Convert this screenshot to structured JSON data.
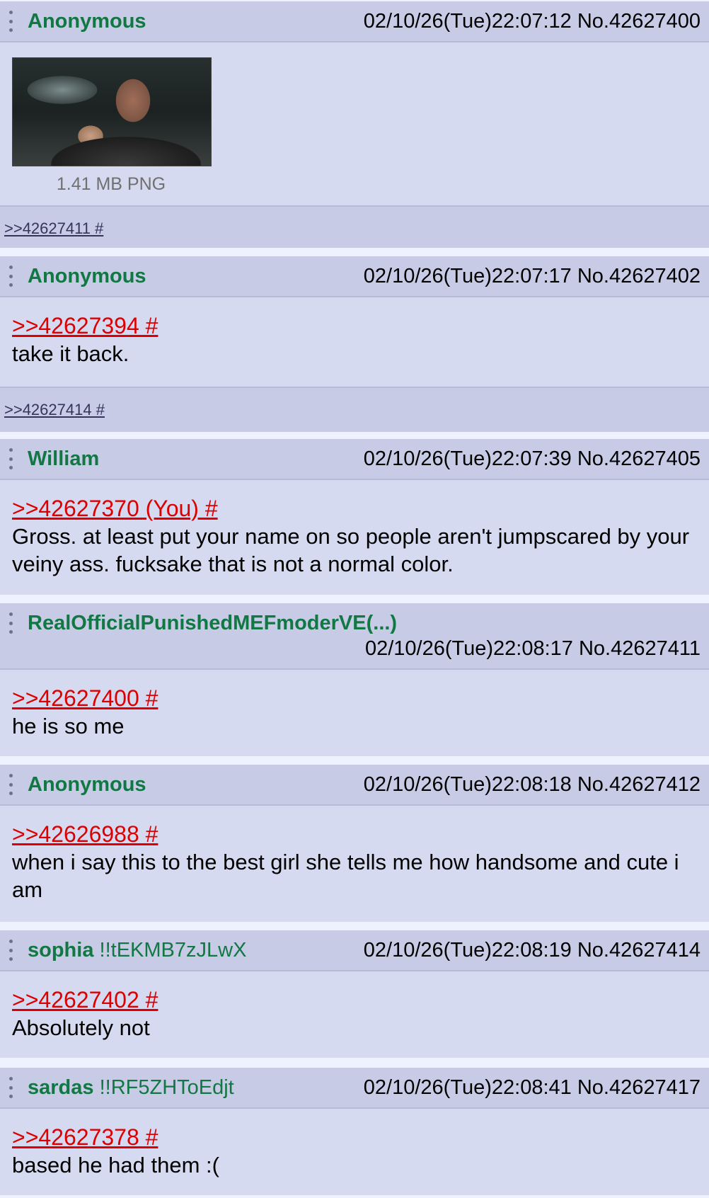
{
  "posts": [
    {
      "name": "Anonymous",
      "datetime": "02/10/26(Tue)22:07:12",
      "no": "No.42627400",
      "file_info": "1.41 MB PNG",
      "backlinks": ">>42627411 #"
    },
    {
      "name": "Anonymous",
      "datetime": "02/10/26(Tue)22:07:17",
      "no": "No.42627402",
      "quote": ">>42627394 #",
      "text": "take it back.",
      "backlinks": ">>42627414 #"
    },
    {
      "name": "William",
      "datetime": "02/10/26(Tue)22:07:39",
      "no": "No.42627405",
      "quote": ">>42627370 (You) #",
      "text": "Gross. at least put your name on so people aren't jumpscared by your veiny ass. fucksake that is not a normal color."
    },
    {
      "name": "RealOfficialPunishedMEFmoderVE(...)",
      "datetime": "02/10/26(Tue)22:08:17",
      "no": "No.42627411",
      "quote": ">>42627400 #",
      "text": "he is so me"
    },
    {
      "name": "Anonymous",
      "datetime": "02/10/26(Tue)22:08:18",
      "no": "No.42627412",
      "quote": ">>42626988 #",
      "text": "when i say this to the best girl she tells me how handsome and cute i am"
    },
    {
      "name": "sophia",
      "trip": "!!tEKMB7zJLwX",
      "datetime": "02/10/26(Tue)22:08:19",
      "no": "No.42627414",
      "quote": ">>42627402 #",
      "text": "Absolutely not"
    },
    {
      "name": "sardas",
      "trip": "!!RF5ZHToEdjt",
      "datetime": "02/10/26(Tue)22:08:41",
      "no": "No.42627417",
      "quote": ">>42627378 #",
      "text": "based he had them :("
    }
  ],
  "colors": {
    "post_bg": "#d6daf0",
    "header_bg": "#c7cbe6",
    "name": "#117743",
    "quote": "#dd0000",
    "page_bg": "#eef2ff"
  },
  "icons": [
    "more-vertical-icon"
  ]
}
